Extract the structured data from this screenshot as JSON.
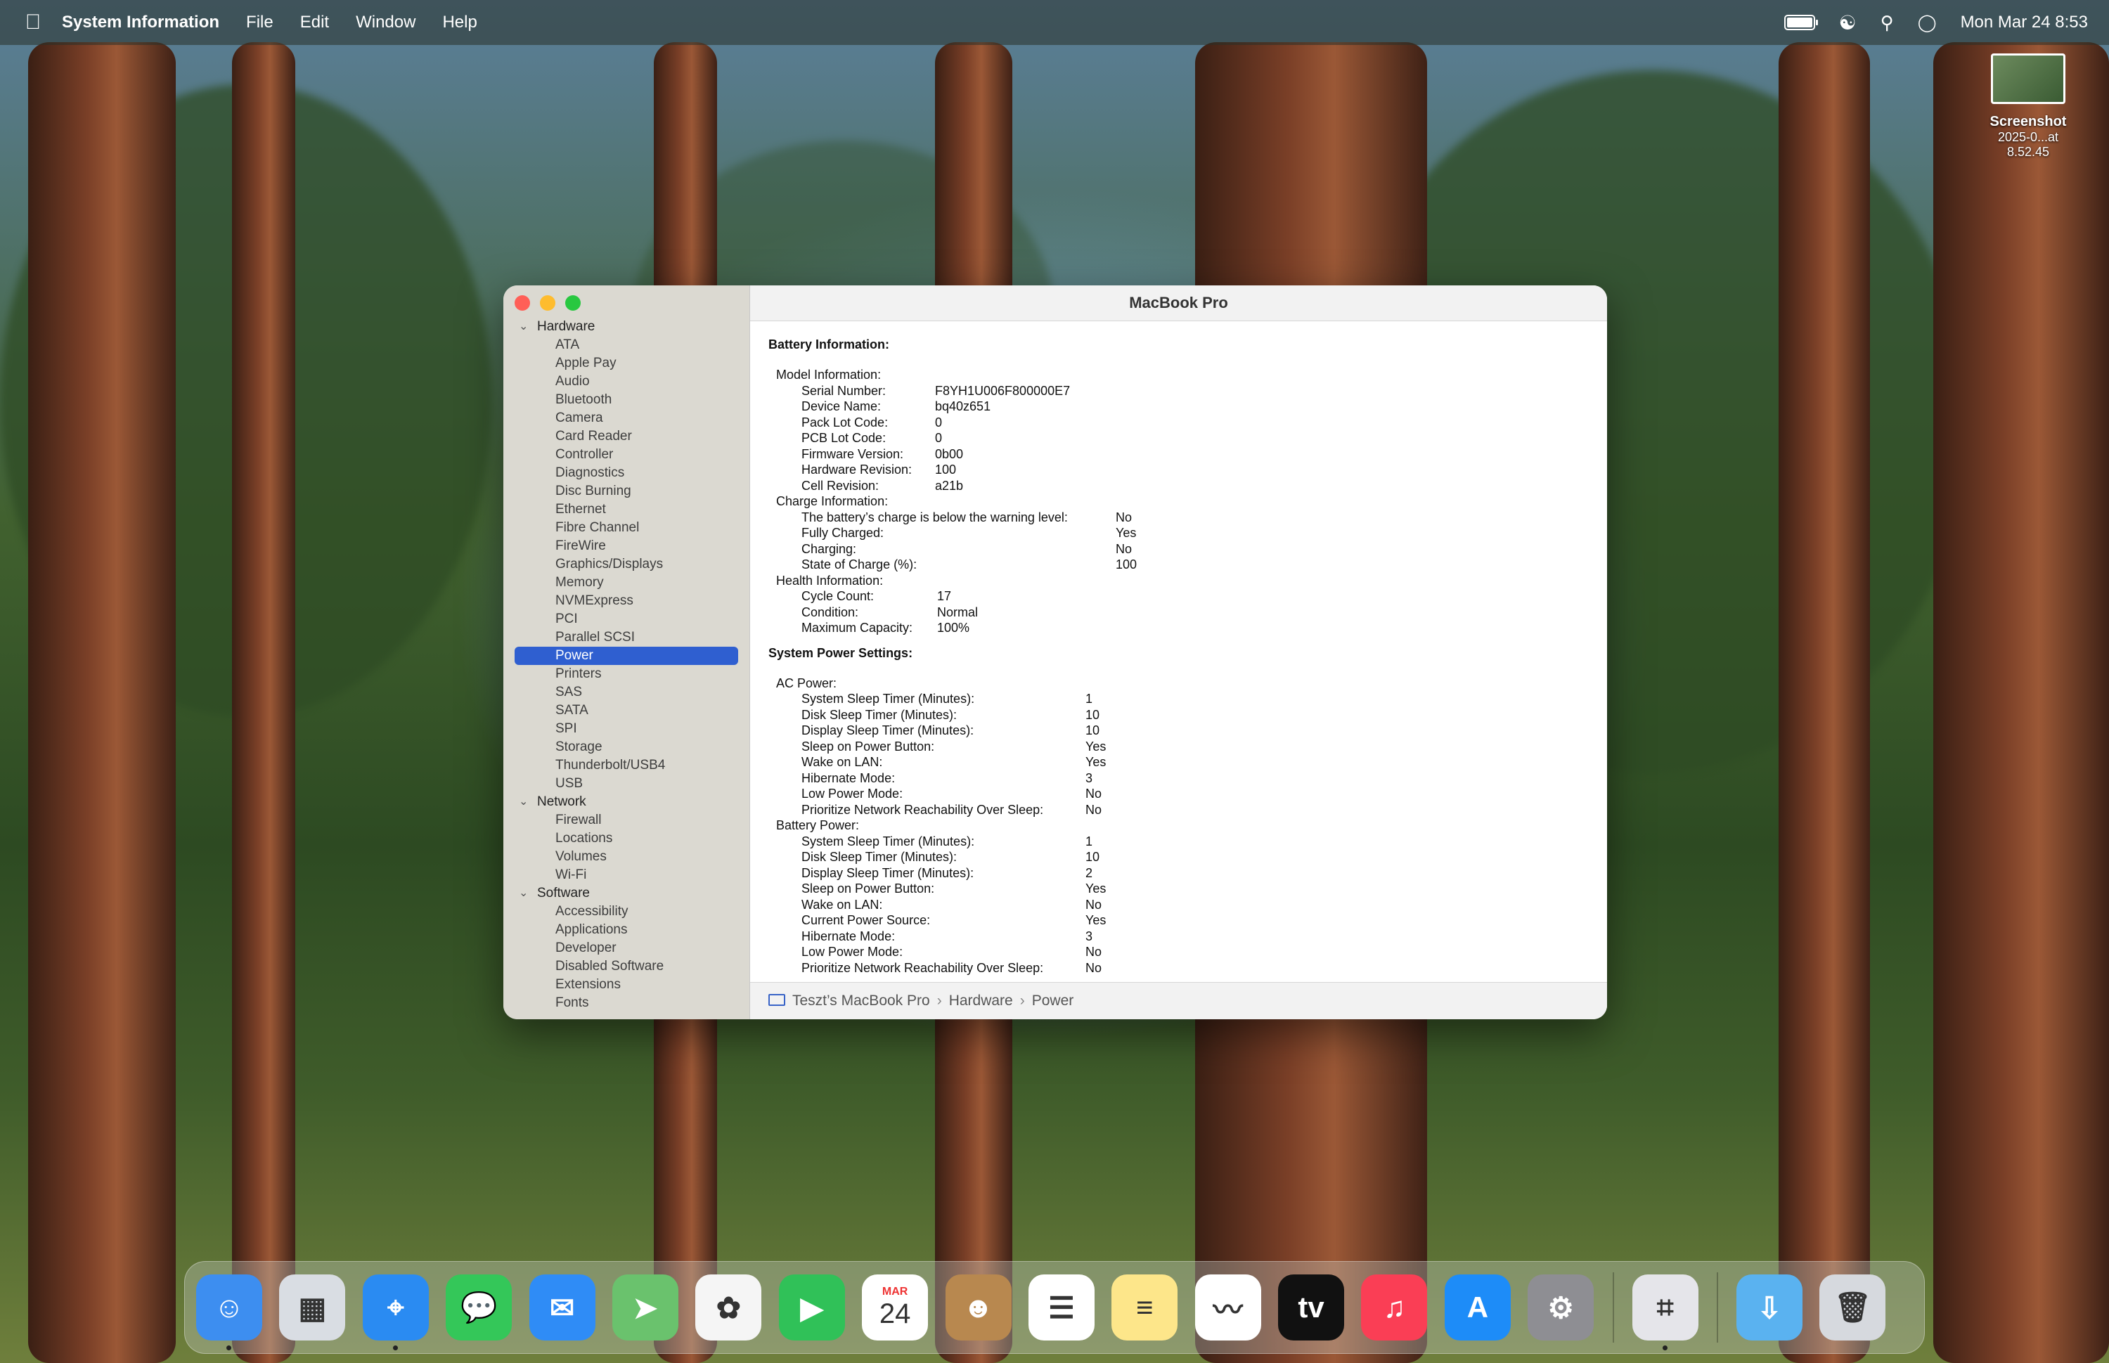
{
  "menubar": {
    "app_name": "System Information",
    "menus": [
      "File",
      "Edit",
      "Window",
      "Help"
    ],
    "clock": "Mon Mar 24  8:53"
  },
  "desktop": {
    "file_name": "Screenshot",
    "file_date": "2025-0...at 8.52.45"
  },
  "window": {
    "title": "MacBook Pro",
    "sidebar": [
      {
        "group": "Hardware",
        "items": [
          "ATA",
          "Apple Pay",
          "Audio",
          "Bluetooth",
          "Camera",
          "Card Reader",
          "Controller",
          "Diagnostics",
          "Disc Burning",
          "Ethernet",
          "Fibre Channel",
          "FireWire",
          "Graphics/Displays",
          "Memory",
          "NVMExpress",
          "PCI",
          "Parallel SCSI",
          "Power",
          "Printers",
          "SAS",
          "SATA",
          "SPI",
          "Storage",
          "Thunderbolt/USB4",
          "USB"
        ]
      },
      {
        "group": "Network",
        "items": [
          "Firewall",
          "Locations",
          "Volumes",
          "Wi-Fi"
        ]
      },
      {
        "group": "Software",
        "items": [
          "Accessibility",
          "Applications",
          "Developer",
          "Disabled Software",
          "Extensions",
          "Fonts"
        ]
      }
    ],
    "selected_item": "Power",
    "battery_heading": "Battery Information:",
    "model_info": {
      "label": "Model Information:",
      "rows": [
        [
          "Serial Number:",
          "F8YH1U006F800000E7"
        ],
        [
          "Device Name:",
          "bq40z651"
        ],
        [
          "Pack Lot Code:",
          "0"
        ],
        [
          "PCB Lot Code:",
          "0"
        ],
        [
          "Firmware Version:",
          "0b00"
        ],
        [
          "Hardware Revision:",
          "100"
        ],
        [
          "Cell Revision:",
          "a21b"
        ]
      ]
    },
    "charge_info": {
      "label": "Charge Information:",
      "rows": [
        [
          "The battery’s charge is below the warning level:",
          "No"
        ],
        [
          "Fully Charged:",
          "Yes"
        ],
        [
          "Charging:",
          "No"
        ],
        [
          "State of Charge (%):",
          "100"
        ]
      ]
    },
    "health_info": {
      "label": "Health Information:",
      "rows": [
        [
          "Cycle Count:",
          "17"
        ],
        [
          "Condition:",
          "Normal"
        ],
        [
          "Maximum Capacity:",
          "100%"
        ]
      ]
    },
    "power_heading": "System Power Settings:",
    "ac_power": {
      "label": "AC Power:",
      "rows": [
        [
          "System Sleep Timer (Minutes):",
          "1"
        ],
        [
          "Disk Sleep Timer (Minutes):",
          "10"
        ],
        [
          "Display Sleep Timer (Minutes):",
          "10"
        ],
        [
          "Sleep on Power Button:",
          "Yes"
        ],
        [
          "Wake on LAN:",
          "Yes"
        ],
        [
          "Hibernate Mode:",
          "3"
        ],
        [
          "Low Power Mode:",
          "No"
        ],
        [
          "Prioritize Network Reachability Over Sleep:",
          "No"
        ]
      ]
    },
    "battery_power": {
      "label": "Battery Power:",
      "rows": [
        [
          "System Sleep Timer (Minutes):",
          "1"
        ],
        [
          "Disk Sleep Timer (Minutes):",
          "10"
        ],
        [
          "Display Sleep Timer (Minutes):",
          "2"
        ],
        [
          "Sleep on Power Button:",
          "Yes"
        ],
        [
          "Wake on LAN:",
          "No"
        ],
        [
          "Current Power Source:",
          "Yes"
        ],
        [
          "Hibernate Mode:",
          "3"
        ],
        [
          "Low Power Mode:",
          "No"
        ],
        [
          "Prioritize Network Reachability Over Sleep:",
          "No"
        ]
      ]
    },
    "breadcrumb": [
      "Teszt’s MacBook Pro",
      "Hardware",
      "Power"
    ]
  },
  "dock": {
    "apps": [
      {
        "name": "finder-icon",
        "color": "#3d8ef0",
        "glyph": "☺",
        "running": true
      },
      {
        "name": "launchpad-icon",
        "color": "#d9dde3",
        "glyph": "▦",
        "running": false
      },
      {
        "name": "safari-icon",
        "color": "#2a8bf2",
        "glyph": "⌖",
        "running": true
      },
      {
        "name": "messages-icon",
        "color": "#34c759",
        "glyph": "💬",
        "running": false
      },
      {
        "name": "mail-icon",
        "color": "#2f8cf6",
        "glyph": "✉",
        "running": false
      },
      {
        "name": "maps-icon",
        "color": "#6ac26d",
        "glyph": "➤",
        "running": false
      },
      {
        "name": "photos-icon",
        "color": "#f5f5f5",
        "glyph": "✿",
        "running": false
      },
      {
        "name": "facetime-icon",
        "color": "#30c158",
        "glyph": "▶",
        "running": false
      },
      {
        "name": "calendar-icon",
        "color": "#ffffff",
        "glyph": "24",
        "month": "MAR",
        "running": false
      },
      {
        "name": "contacts-icon",
        "color": "#b8884f",
        "glyph": "☻",
        "running": false
      },
      {
        "name": "reminders-icon",
        "color": "#ffffff",
        "glyph": "☰",
        "running": false
      },
      {
        "name": "notes-icon",
        "color": "#fde68a",
        "glyph": "≡",
        "running": false
      },
      {
        "name": "freeform-icon",
        "color": "#ffffff",
        "glyph": "〰",
        "running": false
      },
      {
        "name": "appletv-icon",
        "color": "#111111",
        "glyph": "tv",
        "running": false
      },
      {
        "name": "music-icon",
        "color": "#fa3e55",
        "glyph": "♫",
        "running": false
      },
      {
        "name": "appstore-icon",
        "color": "#1d8cf8",
        "glyph": "A",
        "running": false
      },
      {
        "name": "system-settings-icon",
        "color": "#8e8e93",
        "glyph": "⚙",
        "running": false
      },
      {
        "name": "system-information-icon",
        "color": "#e5e5ea",
        "glyph": "⌗",
        "running": true
      },
      {
        "name": "downloads-icon",
        "color": "#5ab2f0",
        "glyph": "⇩",
        "running": false
      },
      {
        "name": "trash-icon",
        "color": "#d6d9de",
        "glyph": "🗑",
        "running": false
      }
    ]
  }
}
